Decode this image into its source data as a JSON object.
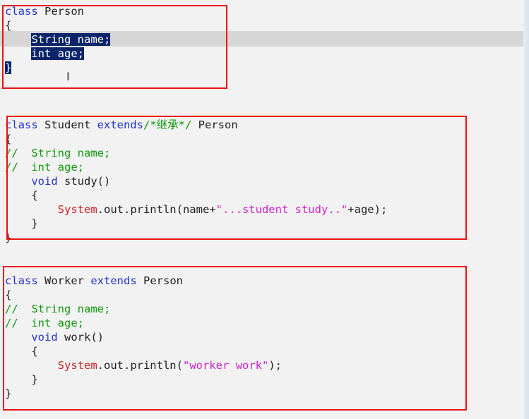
{
  "code": {
    "person": {
      "l1_kw": "class",
      "l1_name": " Person",
      "l2": "{",
      "l3_sel": "String name;",
      "l4_sel": "int age;",
      "l5_sel": "}"
    },
    "student": {
      "l1_kw": "class",
      "l1_name": " Student ",
      "l1_extends": "extends",
      "l1_comment": "/*继承*/",
      "l1_parent": " Person",
      "l2": "{",
      "l3_slash": "//",
      "l3_comment": "String name;",
      "l4_slash": "//",
      "l4_comment": "int age;",
      "l5_kw": "void",
      "l5_name": " study()",
      "l6": "{",
      "l7_sys": "System",
      "l7_mid": ".out.println(name+",
      "l7_str": "\"...student study..\"",
      "l7_end": "+age);",
      "l8": "}",
      "l9": "}"
    },
    "worker": {
      "l1_kw": "class",
      "l1_name": " Worker ",
      "l1_extends": "extends",
      "l1_parent": " Person",
      "l2": "{",
      "l3_slash": "//",
      "l3_comment": "String name;",
      "l4_slash": "//",
      "l4_comment": "int age;",
      "l5_kw": "void",
      "l5_name": " work()",
      "l6": "{",
      "l7_sys": "System",
      "l7_mid": ".out.println(",
      "l7_str": "\"worker work\"",
      "l7_end": ");",
      "l8": "}",
      "l9": "}"
    }
  },
  "colors": {
    "keyword": "#2233cc",
    "comment": "#119911",
    "system": "#cc2222",
    "string": "#cc22cc",
    "selection": "#0a246a",
    "annotation_box": "#ee1111"
  },
  "icons": {
    "caret": "text-cursor-icon"
  }
}
